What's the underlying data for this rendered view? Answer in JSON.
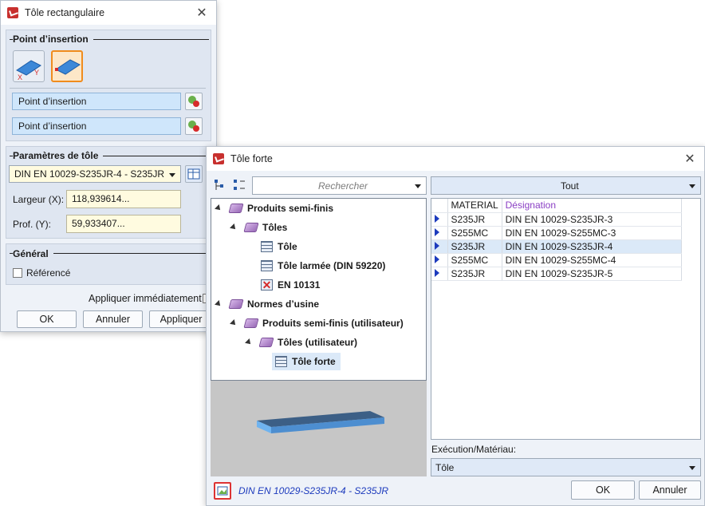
{
  "dialog1": {
    "title": "Tôle rectangulaire",
    "insert_section": "Point d’insertion",
    "insert_field1": "Point d’insertion",
    "insert_field2": "Point d’insertion",
    "params_section": "Paramètres de tôle",
    "material_combo": "DIN EN 10029-S235JR-4 - S235JR",
    "width_label": "Largeur (X):",
    "width_value": "118,939614...",
    "depth_label": "Prof. (Y):",
    "depth_value": "59,933407...",
    "general_section": "Général",
    "referenced_label": "Référencé",
    "apply_immediately": "Appliquer immédiatement",
    "ok": "OK",
    "cancel": "Annuler",
    "apply": "Appliquer"
  },
  "dialog2": {
    "title": "Tôle forte",
    "search_placeholder": "Rechercher",
    "filter": "Tout",
    "tree": {
      "n1": "Produits semi-finis",
      "n2": "Tôles",
      "n3": "Tôle",
      "n4": "Tôle larmée (DIN 59220)",
      "n5": "EN 10131",
      "n6": "Normes d’usine",
      "n7": "Produits semi-finis (utilisateur)",
      "n8": "Tôles (utilisateur)",
      "n9": "Tôle forte"
    },
    "table": {
      "col1": "MATERIAL",
      "col2": "Désignation",
      "rows": [
        {
          "m": "S235JR",
          "d": "DIN EN 10029-S235JR-3"
        },
        {
          "m": "S255MC",
          "d": "DIN EN 10029-S255MC-3"
        },
        {
          "m": "S235JR",
          "d": "DIN EN 10029-S235JR-4"
        },
        {
          "m": "S255MC",
          "d": "DIN EN 10029-S255MC-4"
        },
        {
          "m": "S235JR",
          "d": "DIN EN 10029-S235JR-5"
        }
      ]
    },
    "exec_label": "Exécution/Matériau:",
    "exec_value": "Tôle",
    "footer_text": "DIN EN 10029-S235JR-4 - S235JR",
    "ok": "OK",
    "cancel": "Annuler"
  }
}
